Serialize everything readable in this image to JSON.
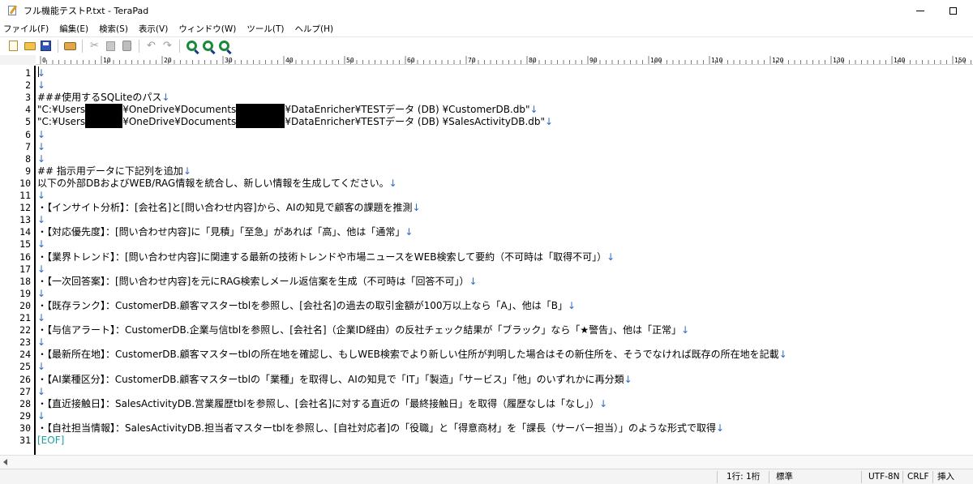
{
  "window": {
    "title": "フル機能テストP.txt - TeraPad"
  },
  "menu": [
    "ファイル(F)",
    "編集(E)",
    "検索(S)",
    "表示(V)",
    "ウィンドウ(W)",
    "ツール(T)",
    "ヘルプ(H)"
  ],
  "toolbar": {
    "icons": [
      "new-file-icon",
      "open-folder-icon",
      "save-icon",
      "print-icon",
      "cut-icon",
      "copy-icon",
      "paste-icon",
      "undo-icon",
      "redo-icon",
      "find-icon",
      "find-next-icon",
      "find-previous-icon"
    ]
  },
  "ruler": {
    "labels": [
      "0",
      "10",
      "20",
      "30",
      "40",
      "50",
      "60",
      "70",
      "80",
      "90",
      "100",
      "110",
      "120",
      "130",
      "140",
      "150"
    ]
  },
  "editor": {
    "eol_mark": "↓",
    "lines": [
      {
        "n": "1",
        "t": ""
      },
      {
        "n": "2",
        "t": ""
      },
      {
        "n": "3",
        "t": "###使用するSQLiteのパス"
      },
      {
        "n": "4",
        "a": "\"C:¥Users",
        "b": "¥OneDrive¥Documents",
        "c": "¥DataEnricher¥TESTデータ (DB) ¥CustomerDB.db\""
      },
      {
        "n": "5",
        "a": "\"C:¥Users",
        "b": "¥OneDrive¥Documents",
        "c": "¥DataEnricher¥TESTデータ (DB) ¥SalesActivityDB.db\""
      },
      {
        "n": "6",
        "t": ""
      },
      {
        "n": "7",
        "t": ""
      },
      {
        "n": "8",
        "t": ""
      },
      {
        "n": "9",
        "t": "## 指示用データに下記列を追加"
      },
      {
        "n": "10",
        "t": "以下の外部DBおよびWEB/RAG情報を統合し、新しい情報を生成してください。"
      },
      {
        "n": "11",
        "t": ""
      },
      {
        "n": "12",
        "t": "・【インサイト分析】：[会社名]と[問い合わせ内容]から、AIの知見で顧客の課題を推測"
      },
      {
        "n": "13",
        "t": ""
      },
      {
        "n": "14",
        "t": "・【対応優先度】：[問い合わせ内容]に「見積」「至急」があれば「高」、他は「通常」"
      },
      {
        "n": "15",
        "t": ""
      },
      {
        "n": "16",
        "t": "・【業界トレンド】：[問い合わせ内容]に関連する最新の技術トレンドや市場ニュースをWEB検索して要約（不可時は「取得不可」）"
      },
      {
        "n": "17",
        "t": ""
      },
      {
        "n": "18",
        "t": "・【一次回答案】：[問い合わせ内容]を元にRAG検索しメール返信案を生成（不可時は「回答不可」）"
      },
      {
        "n": "19",
        "t": ""
      },
      {
        "n": "20",
        "t": "・【既存ランク】：CustomerDB.顧客マスターtblを参照し、[会社名]の過去の取引金額が100万以上なら「A」、他は「B」"
      },
      {
        "n": "21",
        "t": ""
      },
      {
        "n": "22",
        "t": "・【与信アラート】：CustomerDB.企業与信tblを参照し、[会社名]（企業ID経由）の反社チェック結果が「ブラック」なら「★警告」、他は「正常」"
      },
      {
        "n": "23",
        "t": ""
      },
      {
        "n": "24",
        "t": "・【最新所在地】：CustomerDB.顧客マスターtblの所在地を確認し、もしWEB検索でより新しい住所が判明した場合はその新住所を、そうでなければ既存の所在地を記載"
      },
      {
        "n": "25",
        "t": ""
      },
      {
        "n": "26",
        "t": "・【AI業種区分】：CustomerDB.顧客マスターtblの「業種」を取得し、AIの知見で「IT」「製造」「サービス」「他」のいずれかに再分類"
      },
      {
        "n": "27",
        "t": ""
      },
      {
        "n": "28",
        "t": "・【直近接触日】：SalesActivityDB.営業履歴tblを参照し、[会社名]に対する直近の「最終接触日」を取得（履歴なしは「なし」）"
      },
      {
        "n": "29",
        "t": ""
      },
      {
        "n": "30",
        "t": "・【自社担当情報】：SalesActivityDB.担当者マスターtblを参照し、[自社対応者]の「役職」と「得意商材」を「課長（サーバー担当）」のような形式で取得"
      },
      {
        "n": "31",
        "t": "[EOF]",
        "eof": true
      }
    ]
  },
  "status": {
    "position": "1行:  1桁",
    "mode": "標準",
    "encoding": "UTF-8N",
    "newline": "CRLF",
    "insert": "挿入"
  }
}
